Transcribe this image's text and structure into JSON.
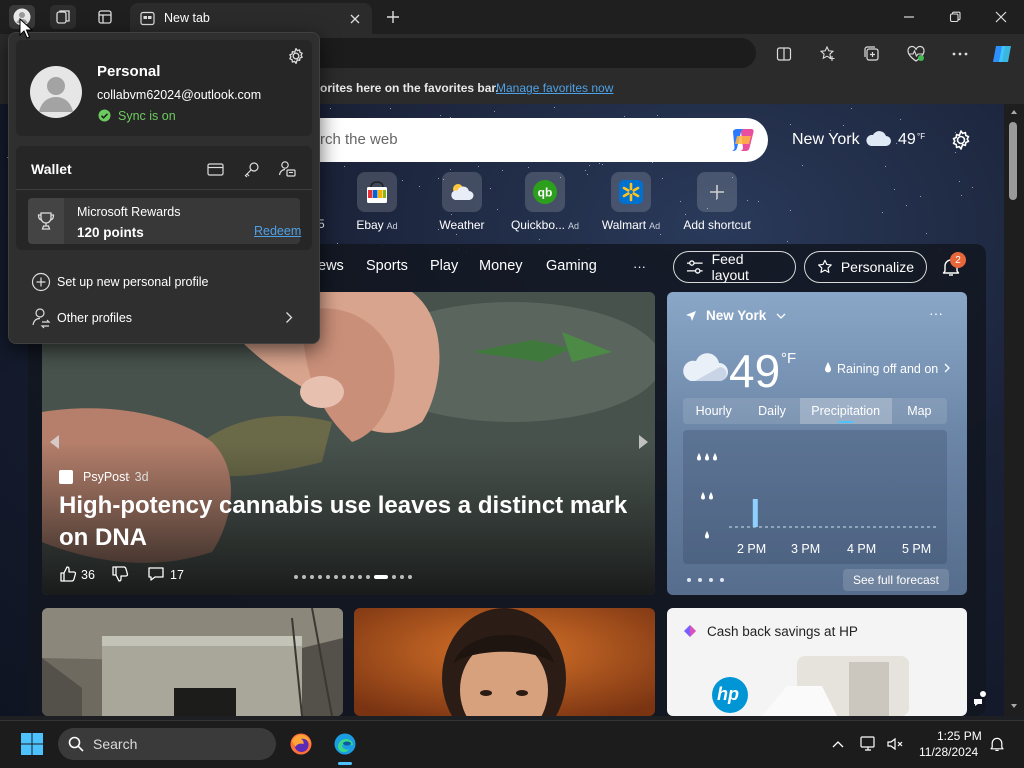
{
  "browser": {
    "tab_title": "New tab",
    "favorites_bar_text": "orites here on the favorites bar.",
    "manage_favorites_link": "Manage favorites now"
  },
  "profile_popup": {
    "name": "Personal",
    "email": "collabvm62024@outlook.com",
    "sync_status": "Sync is on",
    "wallet_label": "Wallet",
    "rewards_title": "Microsoft Rewards",
    "rewards_points": "120 points",
    "redeem_label": "Redeem",
    "setup_profile_label": "Set up new personal profile",
    "other_profiles_label": "Other profiles"
  },
  "newtab": {
    "search_placeholder": "rch the web",
    "location": "New York",
    "temperature": "49",
    "temp_unit": "°F",
    "shortcuts": [
      {
        "label": "Ebay",
        "ad": "Ad",
        "icon": "ebay-icon"
      },
      {
        "label": "Weather",
        "ad": "",
        "icon": "weather-cloud-icon"
      },
      {
        "label": "Quickbo...",
        "ad": "Ad",
        "icon": "quickbooks-icon"
      },
      {
        "label": "Walmart",
        "ad": "Ad",
        "icon": "walmart-icon"
      },
      {
        "label": "Add shortcut",
        "ad": "",
        "icon": "plus-icon"
      }
    ],
    "partial_shortcut_label": "5",
    "nav_items": [
      "ews",
      "Sports",
      "Play",
      "Money",
      "Gaming"
    ],
    "more_label": "···",
    "feed_layout_label": "Feed layout",
    "personalize_label": "Personalize",
    "notification_count": "2"
  },
  "hero": {
    "source": "PsyPost",
    "age": "3d",
    "headline": "High-potency cannabis use leaves a distinct mark on DNA",
    "likes": "36",
    "comments": "17"
  },
  "weather_card": {
    "city": "New York",
    "temperature": "49",
    "unit": "°F",
    "condition": "Raining off and on",
    "tabs": [
      "Hourly",
      "Daily",
      "Precipitation",
      "Map"
    ],
    "active_tab": "Precipitation",
    "time_labels": [
      "2 PM",
      "3 PM",
      "4 PM",
      "5 PM"
    ],
    "see_forecast_label": "See full forecast",
    "precip_levels": [
      0,
      0,
      0.35,
      0,
      0,
      0,
      0,
      0,
      0,
      0,
      0,
      0,
      0,
      0,
      0,
      0,
      0,
      0,
      0,
      0
    ]
  },
  "promo_card": {
    "title": "Cash back savings at HP",
    "logo_text": "hp"
  },
  "taskbar": {
    "search_placeholder": "Search",
    "time": "1:25 PM",
    "date": "11/28/2024"
  },
  "colors": {
    "accent": "#4cc2ff",
    "link": "#4ea1e6",
    "sync_green": "#6ccb5f",
    "badge_orange": "#e8673a"
  }
}
